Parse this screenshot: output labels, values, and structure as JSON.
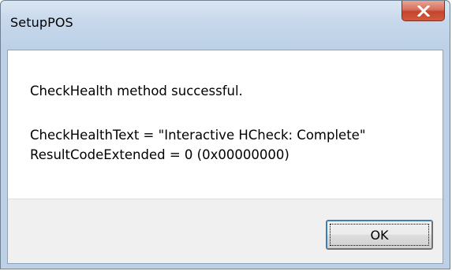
{
  "window": {
    "title": "SetupPOS",
    "close_icon": "close-icon"
  },
  "message": {
    "line1": "CheckHealth method successful.",
    "line2": "CheckHealthText = \"Interactive HCheck: Complete\"",
    "line3": "ResultCodeExtended = 0 (0x00000000)"
  },
  "buttons": {
    "ok_label": "OK"
  },
  "colors": {
    "close_button": "#c3452c",
    "title_bar": "#c6d7ea",
    "footer": "#f0f0f0"
  }
}
